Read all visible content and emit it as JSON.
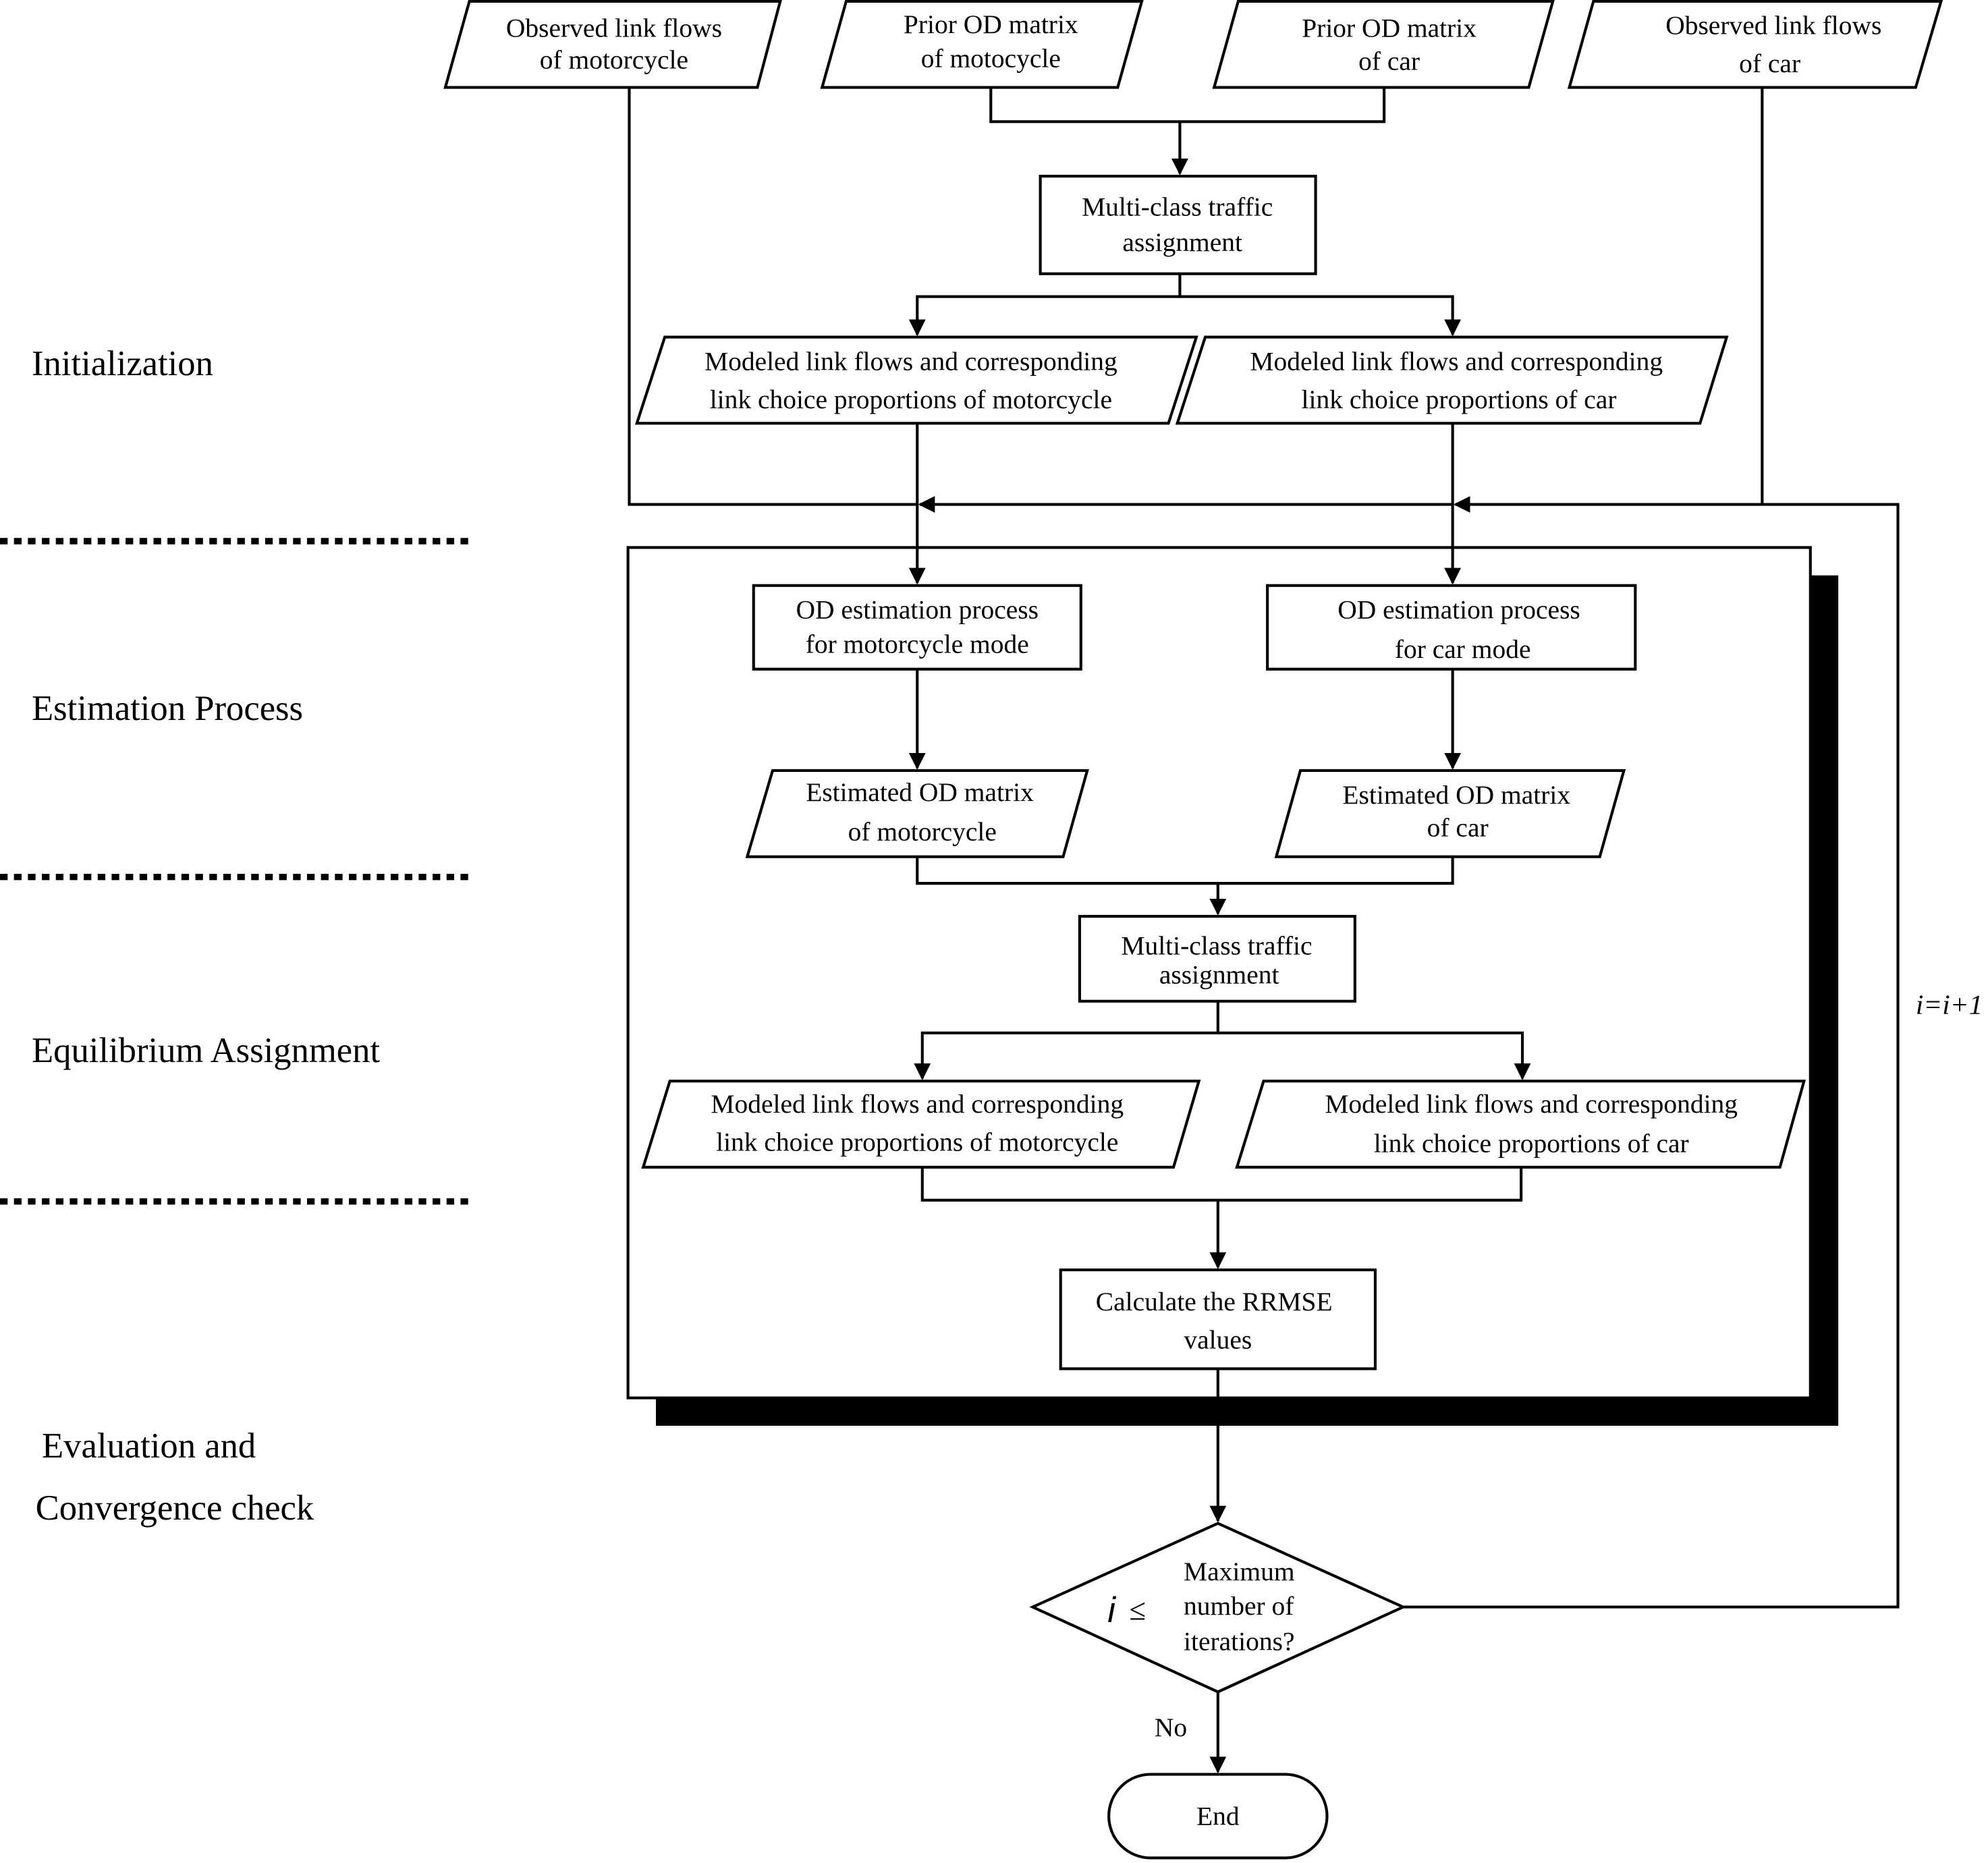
{
  "stages": {
    "initialization": "Initialization",
    "estimation": "Estimation Process",
    "equilibrium": "Equilibrium Assignment",
    "evaluation_line1": "Evaluation and",
    "evaluation_line2": "Convergence check"
  },
  "inputs": {
    "obs_moto": [
      "Observed link flows",
      "of motorcycle"
    ],
    "prior_moto": [
      "Prior OD matrix",
      "of motocycle"
    ],
    "prior_car": [
      "Prior OD matrix",
      "of car"
    ],
    "obs_car": [
      "Observed link flows",
      "of car"
    ]
  },
  "init": {
    "assign": [
      "Multi-class traffic",
      "assignment"
    ],
    "modeled_moto": [
      "Modeled link flows and corresponding",
      "link choice proportions of motorcycle"
    ],
    "modeled_car": [
      "Modeled link flows and corresponding",
      "link choice proportions of car"
    ]
  },
  "loop": {
    "est_moto": [
      "OD estimation process",
      "for motorcycle mode"
    ],
    "est_car": [
      "OD estimation process",
      "for car mode"
    ],
    "od_moto": [
      "Estimated OD matrix",
      "of motorcycle"
    ],
    "od_car": [
      "Estimated OD matrix",
      "of car"
    ],
    "assign": [
      "Multi-class traffic",
      "assignment"
    ],
    "modeled_moto": [
      "Modeled link flows and corresponding",
      "link choice proportions of motorcycle"
    ],
    "modeled_car": [
      "Modeled link flows and corresponding",
      "link choice proportions of car"
    ],
    "rrmse": [
      "Calculate the RRMSE",
      "values"
    ]
  },
  "decision": {
    "var": "i",
    "op": "≤",
    "text": [
      "Maximum",
      "number of",
      "iterations?"
    ],
    "no_label": "No",
    "loop_label": "i=i+1"
  },
  "end": {
    "label": "End"
  }
}
